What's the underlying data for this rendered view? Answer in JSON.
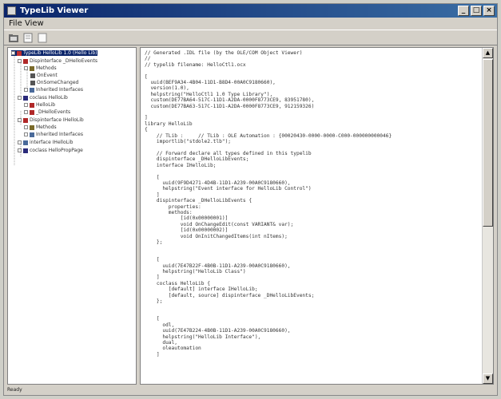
{
  "window": {
    "title": "TypeLib Viewer"
  },
  "menu": {
    "items": [
      "File",
      "View"
    ]
  },
  "toolbar": {
    "buttons": [
      "open-file-icon",
      "save-icon",
      "view-icon"
    ]
  },
  "tree": {
    "items": [
      {
        "label": "TypeLib HelloLib 1.0 (Hello Lib)",
        "depth": 0,
        "icon": "typelib",
        "selected": true
      },
      {
        "label": "Dispinterface _DHelloEvents",
        "depth": 1,
        "icon": "dispinterface"
      },
      {
        "label": "Methods",
        "depth": 2,
        "icon": "folder"
      },
      {
        "label": "OnEvent",
        "depth": 3,
        "icon": "method"
      },
      {
        "label": "OnSomeChanged",
        "depth": 3,
        "icon": "method"
      },
      {
        "label": "Inherited Interfaces",
        "depth": 2,
        "icon": "interface"
      },
      {
        "label": "coclass HelloLib",
        "depth": 1,
        "icon": "coclass"
      },
      {
        "label": "HelloLib",
        "depth": 2,
        "icon": "dispinterface"
      },
      {
        "label": "_DHelloEvents",
        "depth": 2,
        "icon": "dispinterface"
      },
      {
        "label": "Dispinterface IHelloLib",
        "depth": 1,
        "icon": "dispinterface"
      },
      {
        "label": "Methods",
        "depth": 2,
        "icon": "folder"
      },
      {
        "label": "Inherited Interfaces",
        "depth": 2,
        "icon": "interface"
      },
      {
        "label": "interface IHelloLib",
        "depth": 1,
        "icon": "interface"
      },
      {
        "label": "coclass HelloPropPage",
        "depth": 1,
        "icon": "coclass"
      }
    ]
  },
  "code": {
    "lines": [
      "// Generated .IDL file (by the OLE/COM Object Viewer)",
      "//",
      "// typelib filename: HelloCtl1.ocx",
      "",
      "[",
      "  uuid(BEF9A34-4B04-11D1-B8D4-00A0C9180660),",
      "  version(1.0),",
      "  helpstring(\"HelloCtl1 1.0 Type Library\"),",
      "  custom(DE77BA64-517C-11D1-A2DA-0000F8773CE9, 83951780),",
      "  custom(DE77BA63-517C-11D1-A2DA-0000F8773CE9, 912159326)",
      "",
      "]",
      "library HelloLib",
      "{",
      "    // TLib :     // TLib : OLE Automation : {00020430-0000-0000-C000-000000000046}",
      "    importlib(\"stdole2.tlb\");",
      "",
      "    // Forward declare all types defined in this typelib",
      "    dispinterface _DHelloLibEvents;",
      "    interface IHelloLib;",
      "",
      "    [",
      "      uuid(9F9D4271-4D4B-11D1-A239-00A0C9180660),",
      "      helpstring(\"Event interface for HelloLib Control\")",
      "    ]",
      "    dispinterface _DHelloLibEvents {",
      "        properties:",
      "        methods:",
      "            [id(0x00000001)]",
      "            void OnChangeEdit(const VARIANT& var);",
      "            [id(0x00000002)]",
      "            void OnInitChangedItems(int nItems);",
      "    };",
      "",
      "",
      "    [",
      "      uuid(7E47B22F-4B0B-11D1-A239-00A0C9180660),",
      "      helpstring(\"HelloLib Class\")",
      "    ]",
      "    coclass HelloLib {",
      "        [default] interface IHelloLib;",
      "        [default, source] dispinterface _DHelloLibEvents;",
      "    };",
      "",
      "",
      "    [",
      "      odl,",
      "      uuid(7E47B224-4B0B-11D1-A239-00A0C9180660),",
      "      helpstring(\"HelloLib Interface\"),",
      "      dual,",
      "      oleautomation",
      "    ]"
    ]
  },
  "status": {
    "text": "Ready"
  }
}
